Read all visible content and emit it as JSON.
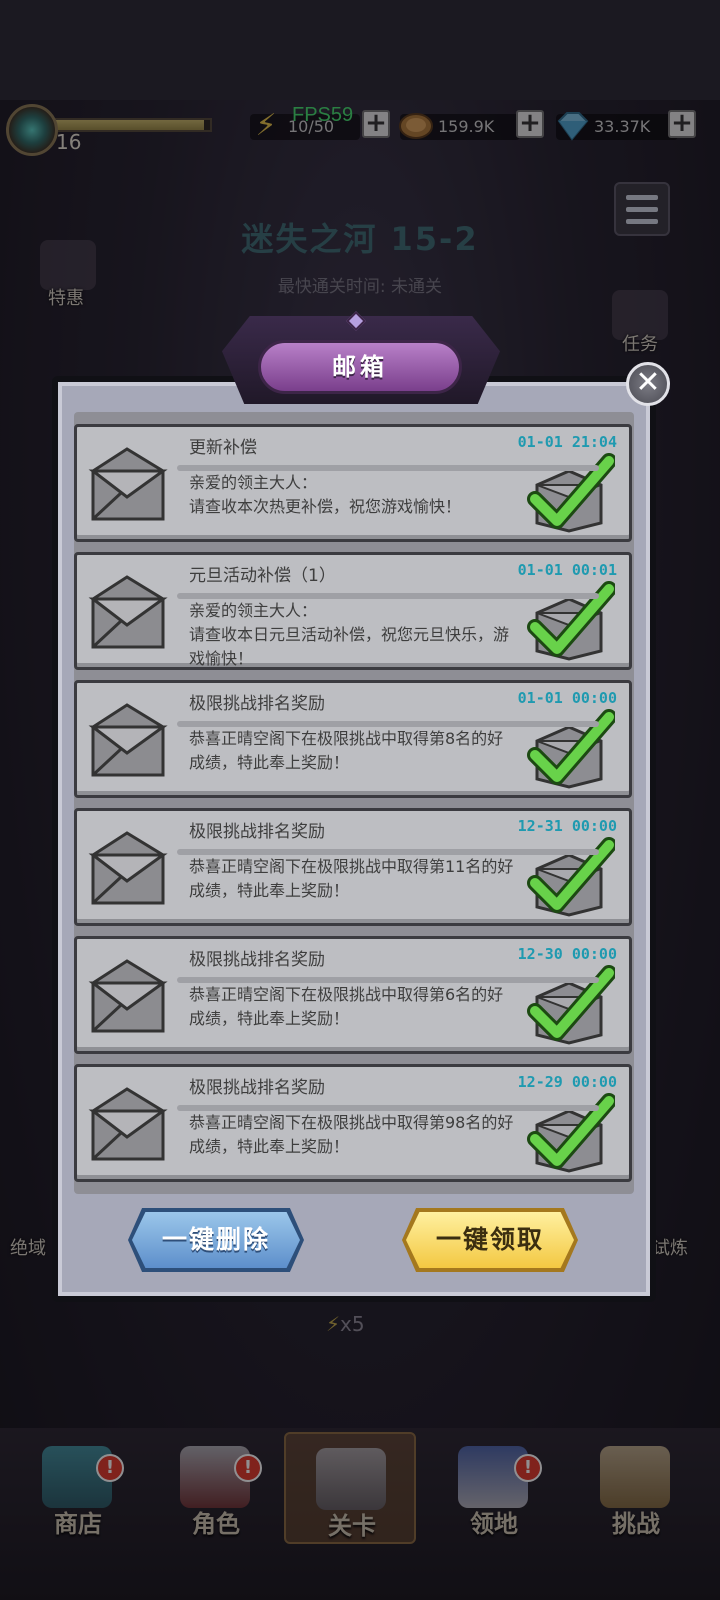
{
  "status_bar": {
    "level": "16",
    "fps": "FPS59",
    "energy": "10/50",
    "gold": "159.9K",
    "gems": "33.37K",
    "plus_symbol": "+"
  },
  "stage": {
    "title": "迷失之河 15-2",
    "fastest_clear": "最快通关时间:  未通关"
  },
  "side_left": {
    "label_1": "特惠",
    "label_2": "绝域"
  },
  "side_right": {
    "label_1": "任务",
    "label_2": "试炼"
  },
  "mailbox": {
    "title": "邮箱",
    "close_symbol": "✕",
    "items": [
      {
        "subject": "更新补偿",
        "time": "01-01 21:04",
        "body": "亲爱的领主大人：\n请查收本次热更补偿，祝您游戏愉快！"
      },
      {
        "subject": "元旦活动补偿（1）",
        "time": "01-01 00:01",
        "body": "亲爱的领主大人：\n请查收本日元旦活动补偿，祝您元旦快乐，游戏愉快！"
      },
      {
        "subject": "极限挑战排名奖励",
        "time": "01-01 00:00",
        "body": "恭喜正晴空阁下在极限挑战中取得第8名的好成绩，特此奉上奖励！"
      },
      {
        "subject": "极限挑战排名奖励",
        "time": "12-31 00:00",
        "body": "恭喜正晴空阁下在极限挑战中取得第11名的好成绩，特此奉上奖励！"
      },
      {
        "subject": "极限挑战排名奖励",
        "time": "12-30 00:00",
        "body": "恭喜正晴空阁下在极限挑战中取得第6名的好成绩，特此奉上奖励！"
      },
      {
        "subject": "极限挑战排名奖励",
        "time": "12-29 00:00",
        "body": "恭喜正晴空阁下在极限挑战中取得第98名的好成绩，特此奉上奖励！"
      }
    ],
    "delete_all_label": "一键删除",
    "claim_all_label": "一键领取"
  },
  "energy_cost": "x5",
  "bottom_nav": {
    "badge": "!",
    "items": [
      {
        "label": "商店"
      },
      {
        "label": "角色"
      },
      {
        "label": "关卡"
      },
      {
        "label": "领地"
      },
      {
        "label": "挑战"
      }
    ]
  },
  "colors": {
    "accent_teal_time": "#1f9ab0",
    "claim_button": "#f3c842",
    "delete_button": "#5d8fcb",
    "title_plate": "#7a3f8c",
    "fps_green": "#46e070"
  }
}
